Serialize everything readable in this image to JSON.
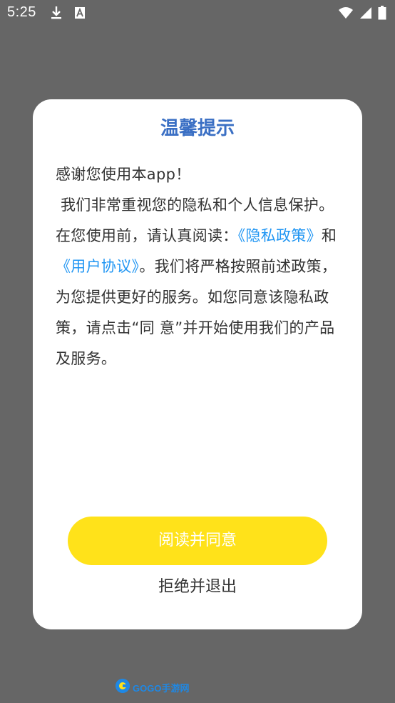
{
  "status_bar": {
    "time": "5:25",
    "icons": [
      "download-icon",
      "font-icon",
      "wifi-icon",
      "signal-icon",
      "battery-icon"
    ]
  },
  "dialog": {
    "title": "温馨提示",
    "body": {
      "line1": "感谢您使用本app！",
      "para_start": " 我们非常重视您的隐私和个人信息保护。在您使用前，请认真阅读：",
      "privacy_link": "《隐私政策》",
      "and": "和",
      "user_agreement_link": "《用户协议》",
      "para_end": "。我们将严格按照前述政策，为您提供更好的服务。如您同意该隐私政策，请点击“同 意”并开始使用我们的产品及服务。"
    },
    "agree_label": "阅读并同意",
    "reject_label": "拒绝并退出"
  },
  "logo": {
    "text": "GOGO手游网"
  },
  "colors": {
    "overlay": "#666666",
    "title": "#3a6fc4",
    "link": "#2196f3",
    "agree_button": "#ffe21a"
  }
}
